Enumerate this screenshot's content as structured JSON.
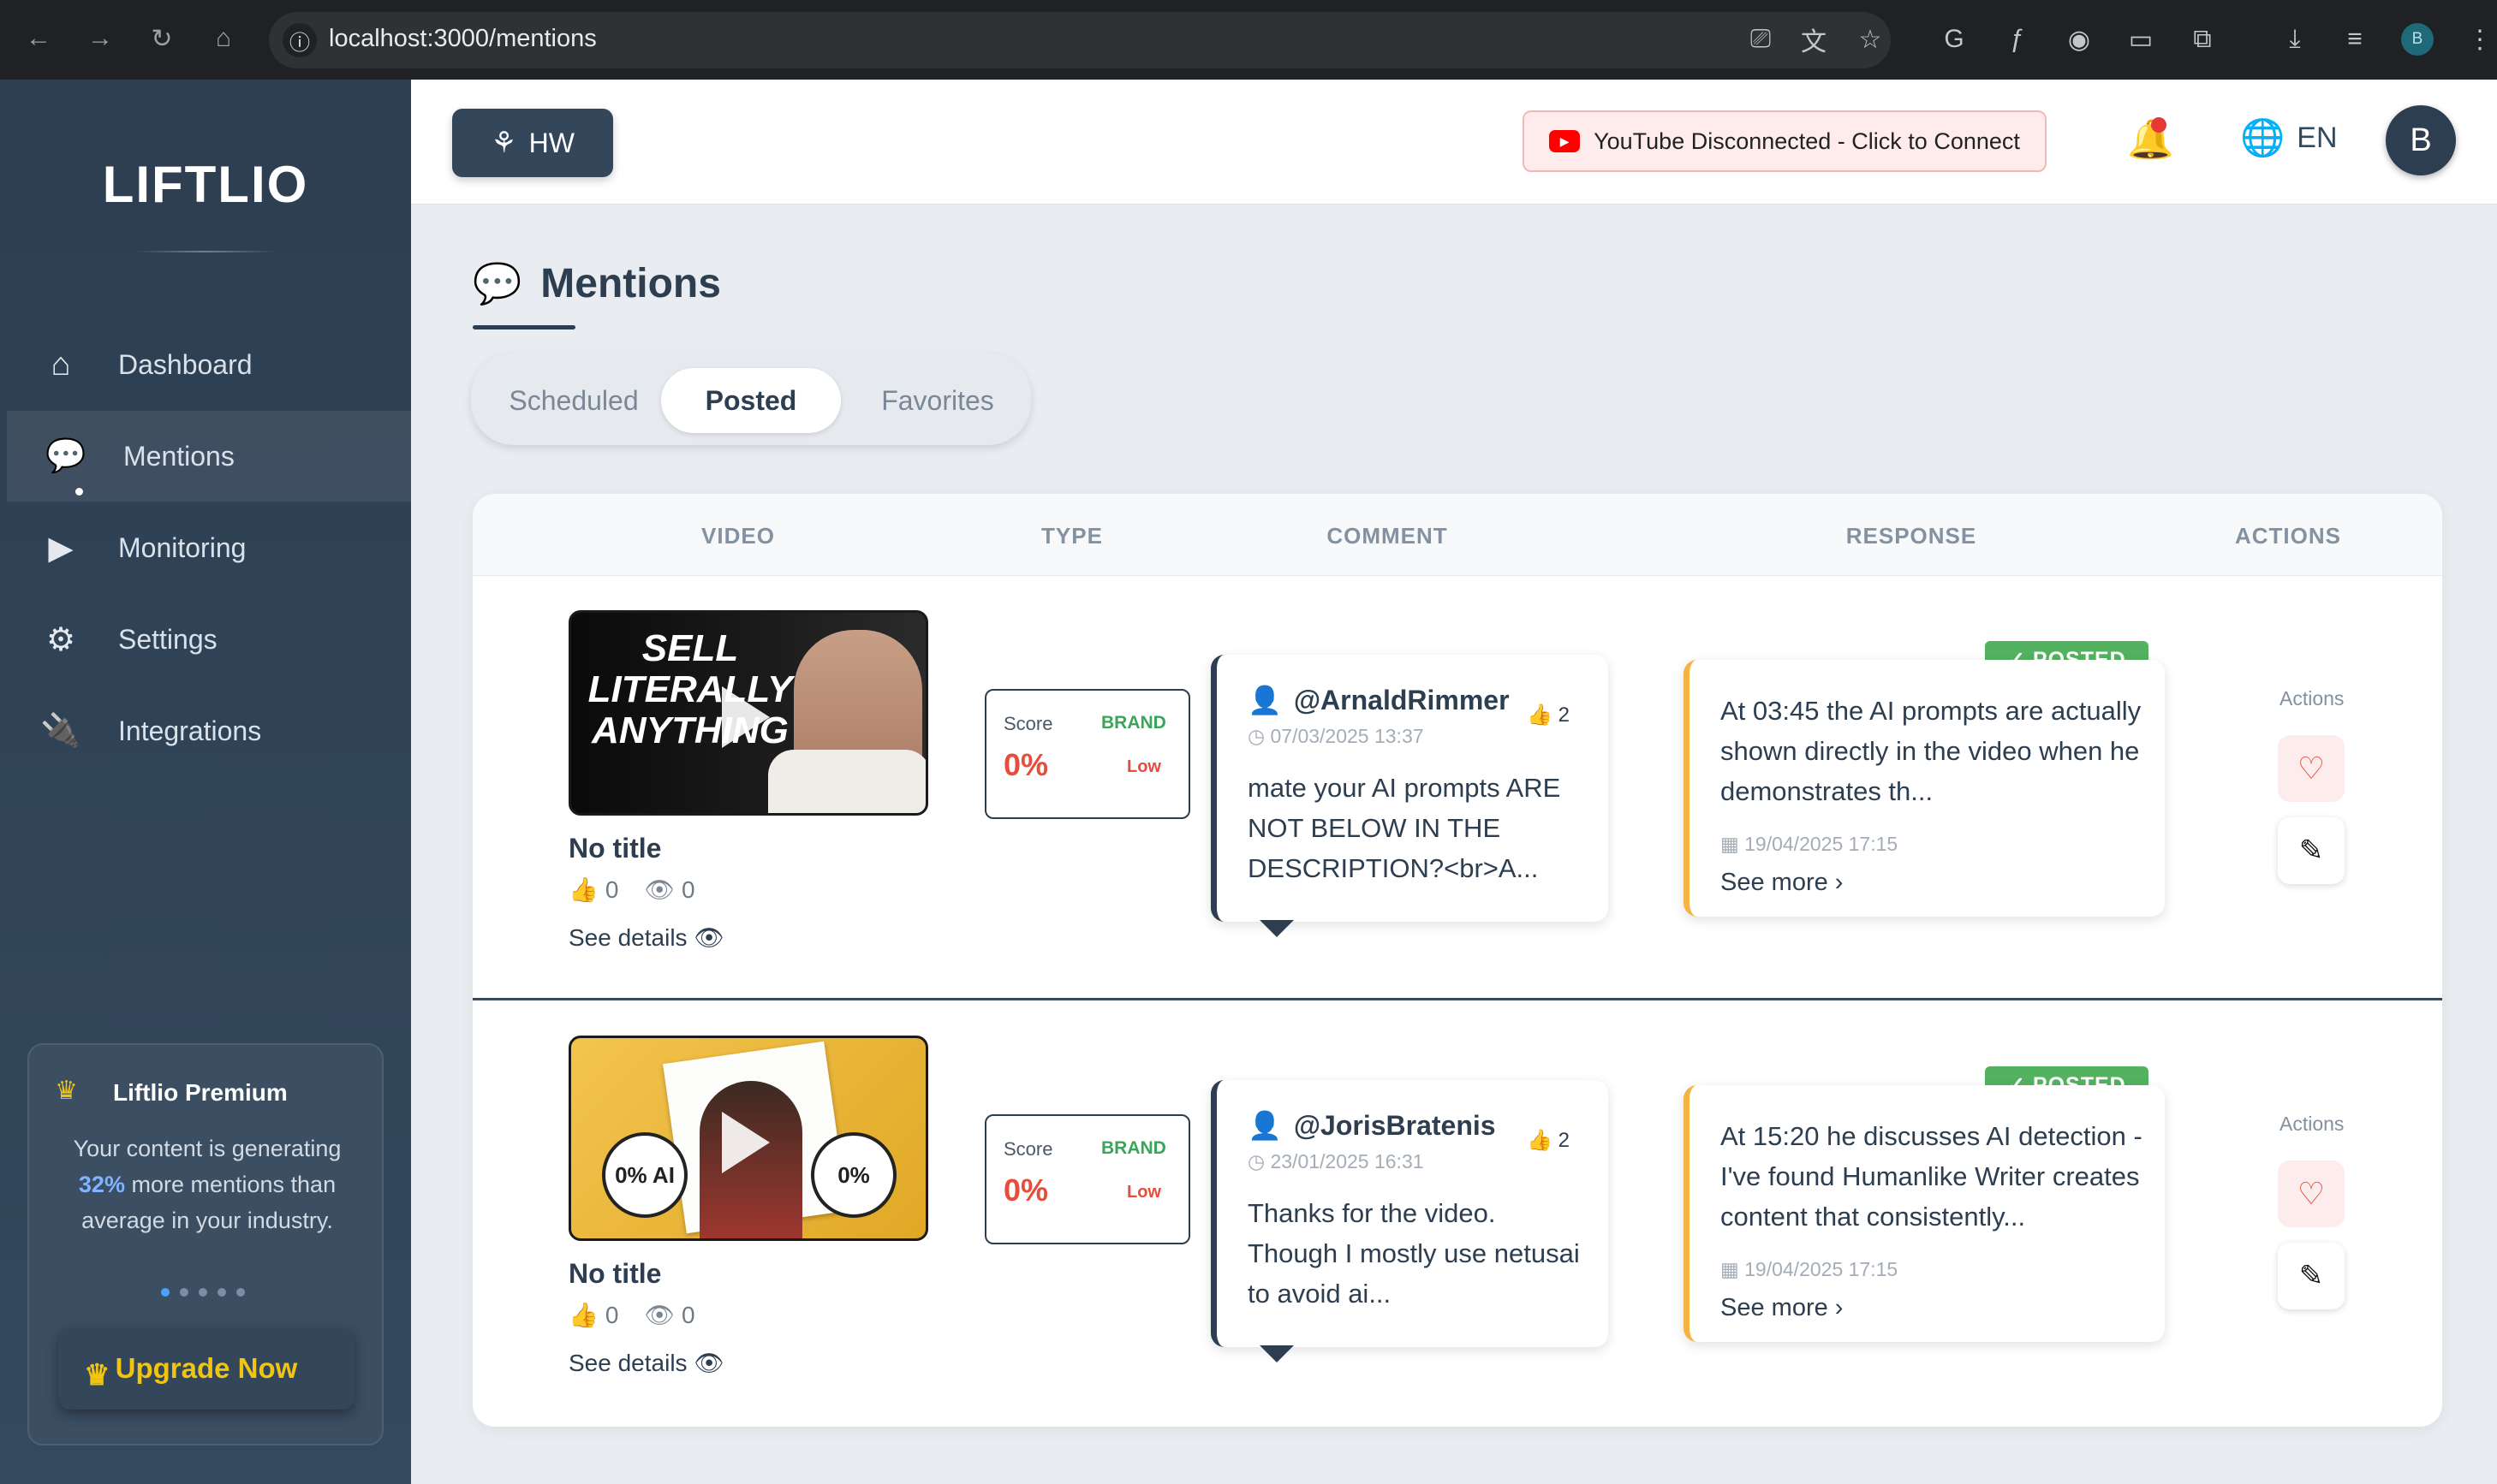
{
  "browser": {
    "url": "localhost:3000/mentions",
    "profile_initial": "B"
  },
  "sidebar": {
    "logo": "LIFTLIO",
    "items": [
      {
        "label": "Dashboard",
        "icon": "home-icon"
      },
      {
        "label": "Mentions",
        "icon": "comments-icon",
        "active": true
      },
      {
        "label": "Monitoring",
        "icon": "youtube-icon"
      },
      {
        "label": "Settings",
        "icon": "gear-icon"
      },
      {
        "label": "Integrations",
        "icon": "plug-icon"
      }
    ],
    "premium": {
      "title": "Liftlio Premium",
      "text_before": "Your content is generating",
      "percent": "32%",
      "text_after": "more mentions than average in your industry.",
      "upgrade_label": "Upgrade Now"
    }
  },
  "header": {
    "project_label": "HW",
    "youtube_status": "YouTube Disconnected - Click to Connect",
    "language": "EN",
    "avatar_initial": "B"
  },
  "page": {
    "title": "Mentions",
    "tabs": [
      "Scheduled",
      "Posted",
      "Favorites"
    ],
    "active_tab": "Posted"
  },
  "table": {
    "headers": [
      "VIDEO",
      "TYPE",
      "COMMENT",
      "RESPONSE",
      "ACTIONS"
    ],
    "rows": [
      {
        "thumb_text": "SELL LITERALLY ANYTHING",
        "video_title": "No title",
        "likes": "0",
        "views": "0",
        "see_details": "See details",
        "score_label": "Score",
        "brand_label": "BRAND",
        "score": "0%",
        "level": "Low",
        "comment_user": "@ArnaldRimmer",
        "comment_likes": "2",
        "comment_date": "07/03/2025 13:37",
        "comment_text": "mate your AI prompts ARE NOT BELOW IN THE DESCRIPTION?<br>A...",
        "status": "POSTED",
        "response_text": "At 03:45 the AI prompts are actually shown directly in the video when he demonstrates th...",
        "response_date": "19/04/2025 17:15",
        "see_more": "See more",
        "actions_label": "Actions"
      },
      {
        "thumb_text_left": "0% AI",
        "thumb_text_right": "0%",
        "video_title": "No title",
        "likes": "0",
        "views": "0",
        "see_details": "See details",
        "score_label": "Score",
        "brand_label": "BRAND",
        "score": "0%",
        "level": "Low",
        "comment_user": "@JorisBratenis",
        "comment_likes": "2",
        "comment_date": "23/01/2025 16:31",
        "comment_text": "Thanks for the video. Though I mostly use netusai to avoid ai...",
        "status": "POSTED",
        "response_text": "At 15:20 he discusses AI detection - I've found Humanlike Writer creates content that consistently...",
        "response_date": "19/04/2025 17:15",
        "see_more": "See more",
        "actions_label": "Actions"
      }
    ]
  },
  "colors": {
    "sidebar": "#2d3e50",
    "posted": "#52b25f",
    "response_accent": "#f5b342",
    "score": "#e74c3c"
  }
}
